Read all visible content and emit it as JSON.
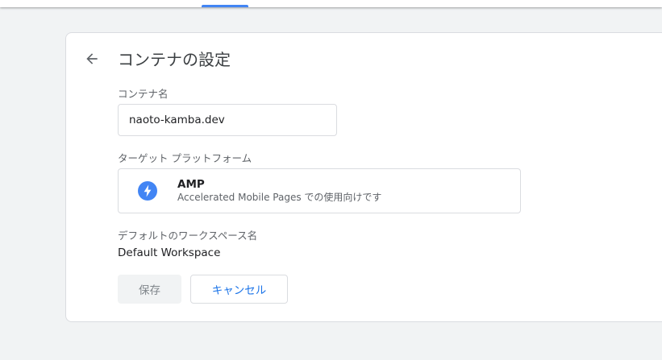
{
  "header": {
    "title": "コンテナの設定"
  },
  "container_name": {
    "label": "コンテナ名",
    "value": "naoto-kamba.dev"
  },
  "target_platform": {
    "label": "ターゲット プラットフォーム",
    "name": "AMP",
    "description": "Accelerated Mobile Pages での使用向けです",
    "icon": "bolt-icon",
    "icon_color": "#4285f4"
  },
  "workspace": {
    "label": "デフォルトのワークスペース名",
    "value": "Default Workspace"
  },
  "actions": {
    "save_label": "保存",
    "cancel_label": "キャンセル"
  },
  "colors": {
    "accent": "#1a73e8",
    "tab_indicator": "#4285f4"
  }
}
